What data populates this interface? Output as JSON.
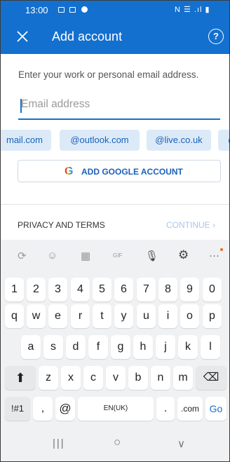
{
  "status_bar": {
    "time": "13:00",
    "indicators": "N ☰ .ıl ▮"
  },
  "app_bar": {
    "close_icon": "close-icon",
    "title": "Add account",
    "help_icon": "?"
  },
  "form": {
    "instruction": "Enter your work or personal email address.",
    "email_placeholder": "Email address",
    "email_value": ""
  },
  "domain_chips": [
    "mail.com",
    "@outlook.com",
    "@live.co.uk",
    "@"
  ],
  "google_button": {
    "g_letter": "G",
    "label": "ADD GOOGLE ACCOUNT"
  },
  "footer": {
    "privacy": "PRIVACY AND TERMS",
    "continue": "CONTINUE ›"
  },
  "keyboard": {
    "toolbar": [
      "⟳",
      "☺",
      "▦",
      "GIF",
      "🎙",
      "⚙",
      "···"
    ],
    "numbers": [
      "1",
      "2",
      "3",
      "4",
      "5",
      "6",
      "7",
      "8",
      "9",
      "0"
    ],
    "row1": [
      "q",
      "w",
      "e",
      "r",
      "t",
      "y",
      "u",
      "i",
      "o",
      "p"
    ],
    "row2": [
      "a",
      "s",
      "d",
      "f",
      "g",
      "h",
      "j",
      "k",
      "l"
    ],
    "row3": [
      "z",
      "x",
      "c",
      "v",
      "b",
      "n",
      "m"
    ],
    "shift": "⬆",
    "backspace": "⌫",
    "symbols": "!#1",
    "comma": ",",
    "at": "@",
    "space": "EN(UK)",
    "period": ".",
    "dotcom": ".com",
    "go": "Go"
  },
  "nav_bar": {
    "recents": "|||",
    "home": "○",
    "back": "∨"
  },
  "colors": {
    "brand": "#1470cf",
    "chip_bg": "#dceaf8",
    "chip_text": "#1b61b8"
  }
}
